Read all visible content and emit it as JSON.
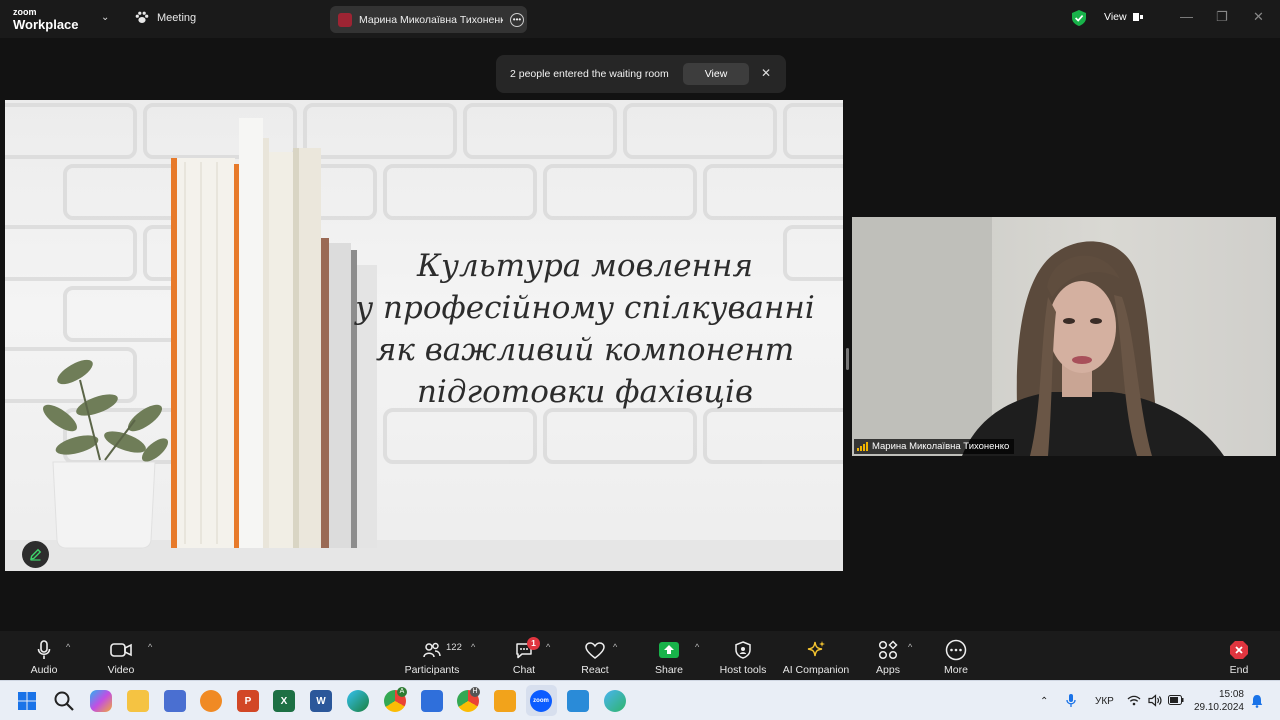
{
  "titlebar": {
    "brand_line1": "zoom",
    "brand_line2": "Workplace",
    "meeting_label": "Meeting",
    "host_name": "Марина Миколаївна Тихоненко",
    "view_label": "View"
  },
  "notification": {
    "text": "2 people entered the waiting room",
    "button_label": "View",
    "close_symbol": "✕"
  },
  "slide": {
    "title_lines": [
      "Культура мовлення",
      "у професійному спілкуванні",
      "як важливий компонент",
      "підготовки фахівців"
    ]
  },
  "participant_video": {
    "name": "Марина Миколаївна Тихоненко"
  },
  "toolbar": {
    "audio": "Audio",
    "video": "Video",
    "participants": "Participants",
    "participants_count": "122",
    "chat": "Chat",
    "chat_badge": "1",
    "react": "React",
    "share": "Share",
    "host_tools": "Host tools",
    "ai_companion": "AI Companion",
    "apps": "Apps",
    "more": "More",
    "end": "End"
  },
  "taskbar": {
    "language": "УКР",
    "time": "15:08",
    "date": "29.10.2024",
    "chrome_badge_a": "A",
    "chrome_badge_b": "H",
    "excel_letter": "X",
    "word_letter": "W",
    "ppt_letter": "P",
    "zoom_label": "zoom"
  },
  "colors": {
    "accent_green": "#18b34a",
    "end_red": "#e0353f",
    "signal_yellow": "#f0b400"
  }
}
